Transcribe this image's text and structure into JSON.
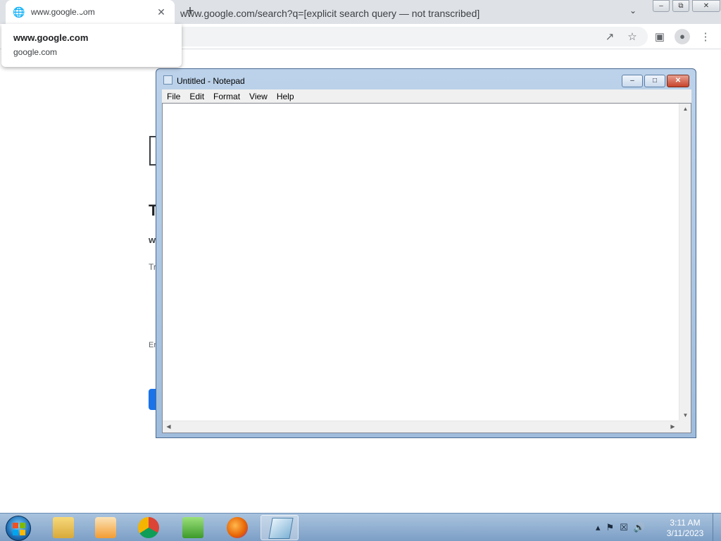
{
  "browser": {
    "tab": {
      "title": "www.google.com"
    },
    "url": "www.google.com/search?q=[explicit search query — not transcribed]",
    "hovercard": {
      "title": "www.google.com",
      "domain": "google.com"
    },
    "page_fragments": {
      "letter_T": "T",
      "letter_w": "w",
      "letter_Tr": "Tr",
      "letter_Er": "Er"
    }
  },
  "notepad": {
    "title": "Untitled - Notepad",
    "menu": [
      "File",
      "Edit",
      "Format",
      "View",
      "Help"
    ],
    "content": ""
  },
  "taskbar": {
    "apps": [
      {
        "name": "File Explorer",
        "icon": "folder-icon"
      },
      {
        "name": "Media Player",
        "icon": "media-player-icon"
      },
      {
        "name": "Google Chrome",
        "icon": "chrome-icon"
      },
      {
        "name": "C# IDE",
        "icon": "csharp-icon"
      },
      {
        "name": "Firefox",
        "icon": "firefox-icon"
      },
      {
        "name": "Notepad",
        "icon": "notepad-icon",
        "active": true
      }
    ],
    "clock": {
      "time": "3:11 AM",
      "date": "3/11/2023"
    }
  },
  "colors": {
    "taskbar_top": "#a9c3de",
    "notepad_frame": "#bcd2ea",
    "chrome_frame": "#dee1e6"
  }
}
